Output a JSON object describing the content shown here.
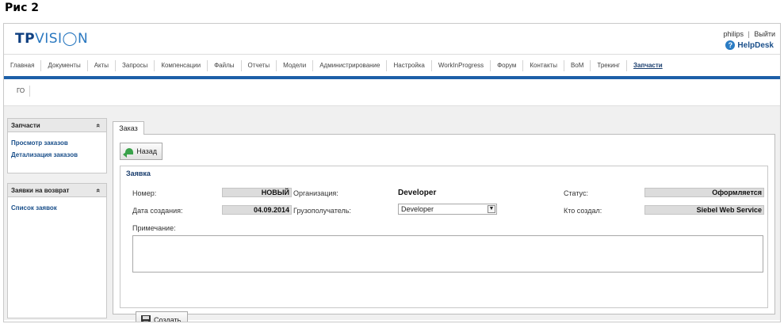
{
  "figure_caption": "Рис 2",
  "header": {
    "logo_tp": "TP",
    "logo_vision": "VISI◯N",
    "user_name": "philips",
    "separator": "|",
    "logout": "Выйти",
    "helpdesk": "HelpDesk"
  },
  "topnav": [
    "Главная",
    "Документы",
    "Акты",
    "Запросы",
    "Компенсации",
    "Файлы",
    "Отчеты",
    "Модели",
    "Администрирование",
    "Настройка",
    "WorkInProgress",
    "Форум",
    "Контакты",
    "BoM",
    "Трекинг",
    "Запчасти"
  ],
  "subnav": {
    "item": "ГО"
  },
  "sidebar": {
    "box1": {
      "title": "Запчасти",
      "links": [
        "Просмотр заказов",
        "Детализация заказов"
      ]
    },
    "box2": {
      "title": "Заявки на возврат",
      "links": [
        "Список заявок"
      ]
    },
    "collapse_glyph": "»"
  },
  "tab": {
    "label": "Заказ"
  },
  "form": {
    "back_label": "Назад",
    "section": "Заявка",
    "number_label": "Номер:",
    "number_value": "НОВЫЙ",
    "org_label": "Организация:",
    "org_value": "Developer",
    "status_label": "Статус:",
    "status_value": "Оформляется",
    "date_label": "Дата создания:",
    "date_value": "04.09.2014",
    "consignee_label": "Грузополучатель:",
    "consignee_value": "Developer",
    "creator_label": "Кто создал:",
    "creator_value": "Siebel Web Service",
    "note_label": "Примечание:",
    "note_value": "",
    "create_label": "Создать"
  },
  "colors": {
    "brand": "#1d5fa8",
    "link": "#1a4f8a"
  },
  "icons": [
    "help-icon",
    "back-arrow-icon",
    "save-icon",
    "chevron-down-icon",
    "collapse-icon"
  ]
}
